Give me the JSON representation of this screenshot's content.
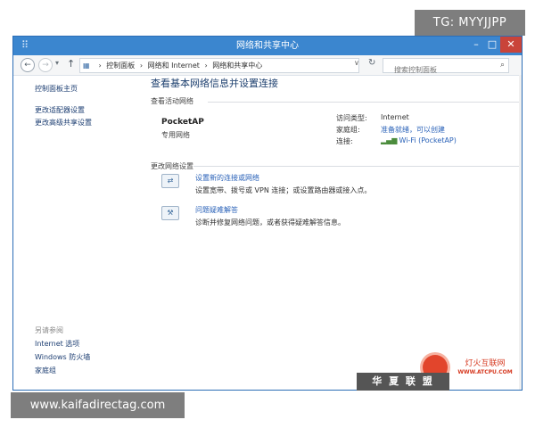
{
  "overlays": {
    "top_tag": "TG: MYYJJPP",
    "bottom_tag": "www.kaifadirectag.com"
  },
  "window": {
    "title": "网络和共享中心",
    "controls": {
      "minimize": "–",
      "maximize": "□",
      "close": "✕"
    }
  },
  "address_bar": {
    "back": "←",
    "forward": "→",
    "recent": "▾",
    "up": "↑",
    "breadcrumbs": [
      "控制面板",
      "网络和 Internet",
      "网络和共享中心"
    ],
    "dropdown": "∨",
    "refresh": "↻",
    "search_placeholder": "搜索控制面板"
  },
  "sidebar": {
    "home": "控制面板主页",
    "links": [
      "更改适配器设置",
      "更改高级共享设置"
    ],
    "see_also_heading": "另请参阅",
    "see_also": [
      "Internet 选项",
      "Windows 防火墙",
      "家庭组"
    ]
  },
  "main": {
    "title": "查看基本网络信息并设置连接",
    "active_networks_label": "查看活动网络",
    "network": {
      "name": "PocketAP",
      "type": "专用网络",
      "access_type_label": "访问类型:",
      "access_type_value": "Internet",
      "homegroup_label": "家庭组:",
      "homegroup_value": "准备就绪，可以创建",
      "connections_label": "连接:",
      "connections_value": "Wi-Fi (PocketAP)"
    },
    "change_settings_label": "更改网络设置",
    "tasks": [
      {
        "link": "设置新的连接或网络",
        "desc": "设置宽带、拨号或 VPN 连接；或设置路由器或接入点。"
      },
      {
        "link": "问题疑难解答",
        "desc": "诊断并修复网络问题，或者获得疑难解答信息。"
      }
    ]
  },
  "watermark": {
    "text": "华 夏 联 盟",
    "site_cn": "灯火互联网",
    "site_url": "WWW.ATCPU.COM"
  }
}
